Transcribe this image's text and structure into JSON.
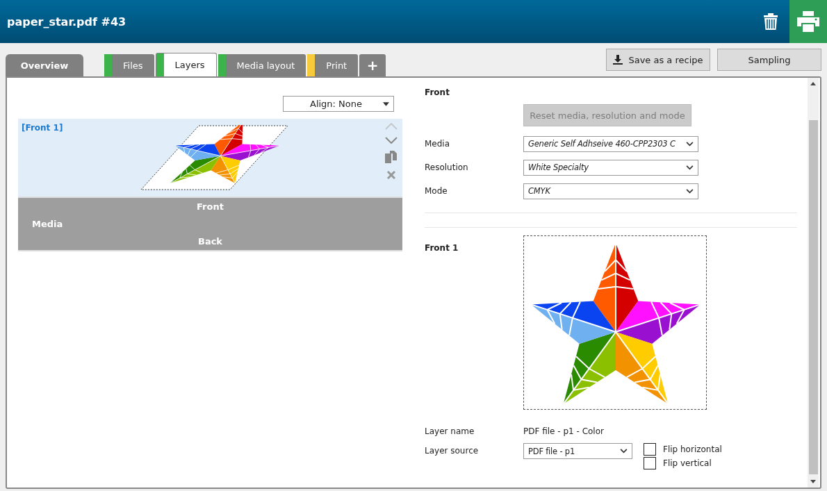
{
  "window": {
    "title": "paper_star.pdf #43"
  },
  "tabs": [
    {
      "label": "Overview",
      "kind": "tab",
      "selected": false
    },
    {
      "label": "Files",
      "kind": "tab",
      "selected": false,
      "color": "#3cb44b"
    },
    {
      "label": "Layers",
      "kind": "tab",
      "selected": true,
      "color": "#3cb44b"
    },
    {
      "label": "Media layout",
      "kind": "tab",
      "selected": false,
      "color": "#3cb44b"
    },
    {
      "label": "Print",
      "kind": "tab",
      "selected": false,
      "color": "#f8cb3c"
    },
    {
      "label": "+",
      "kind": "add",
      "selected": false
    }
  ],
  "actions": [
    {
      "label": "Save as a recipe",
      "kind": "download"
    },
    {
      "label": "Sampling",
      "kind": "plain"
    }
  ],
  "align": {
    "value": "Align: None"
  },
  "layers": [
    {
      "label": "[Front 1]",
      "selected": true
    }
  ],
  "media_block": {
    "front": "Front",
    "label": "Media",
    "back": "Back"
  },
  "front_settings": {
    "heading": "Front",
    "reset_button": {
      "label": "Reset media, resolution and mode",
      "disabled": true
    },
    "fields": [
      {
        "label": "Media",
        "value": "Generic Self Adhseive 460-CPP2303 C"
      },
      {
        "label": "Resolution",
        "value": "White Specialty"
      },
      {
        "label": "Mode",
        "value": "CMYK"
      }
    ]
  },
  "layer": {
    "heading": "Front 1",
    "name_label": "Layer name",
    "name_value": "PDF file - p1 - Color",
    "source_label": "Layer source",
    "source_value": "PDF file - p1",
    "flips": [
      {
        "label": "Flip horizontal",
        "checked": false
      },
      {
        "label": "Flip vertical",
        "checked": false
      }
    ]
  }
}
